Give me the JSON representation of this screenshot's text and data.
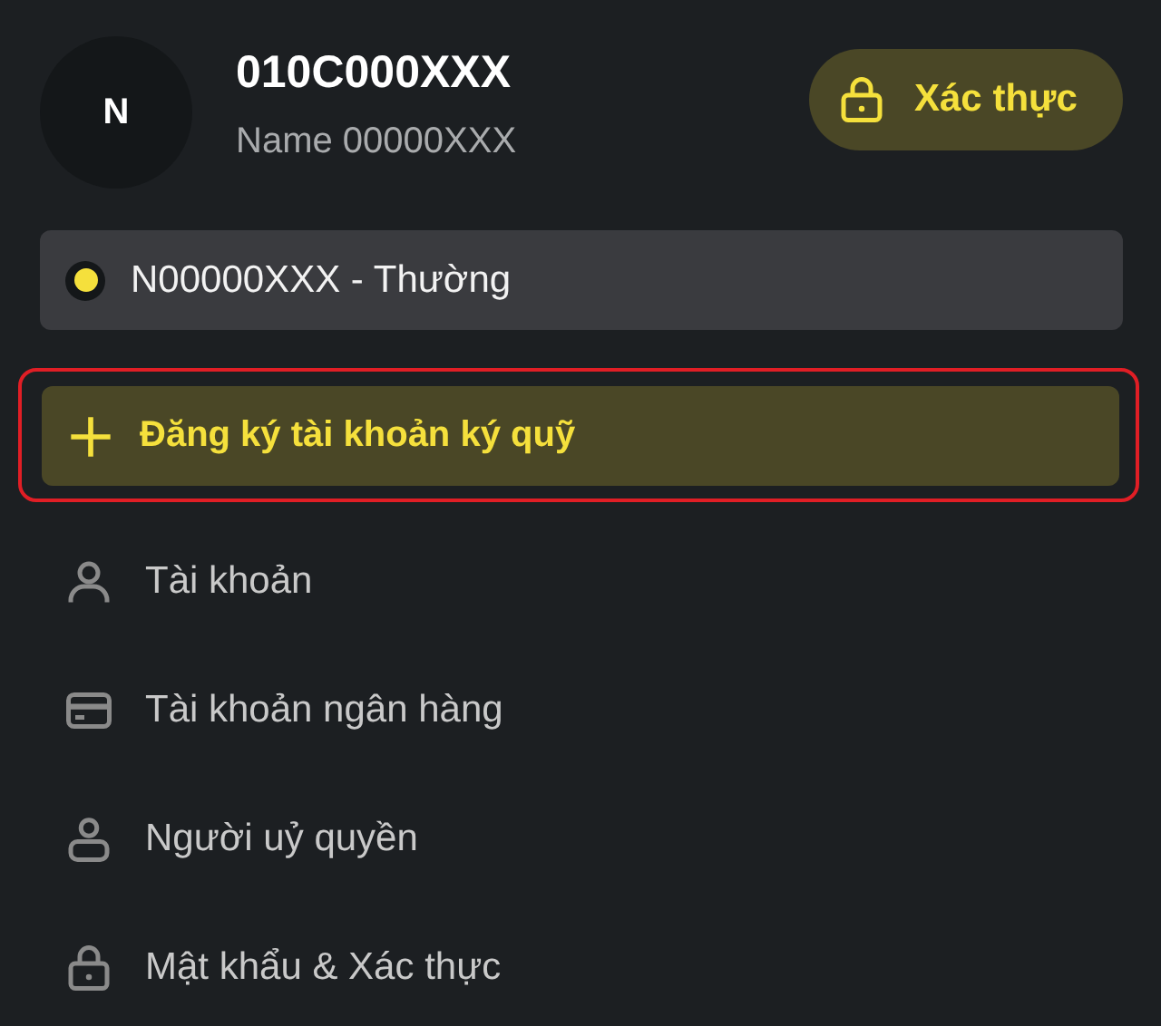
{
  "profile": {
    "avatar_initial": "N",
    "account_id": "010C000XXX",
    "name": "Name 00000XXX"
  },
  "verify_button": {
    "label": "Xác thực"
  },
  "sub_account": {
    "label": "N00000XXX - Thường",
    "color": "#f5e03c"
  },
  "register_button": {
    "label": "Đăng ký tài khoản ký quỹ",
    "highlighted": true
  },
  "menu": [
    {
      "kind": "account",
      "label": "Tài khoản"
    },
    {
      "kind": "bank",
      "label": "Tài khoản ngân hàng"
    },
    {
      "kind": "delegate",
      "label": "Người uỷ quyền"
    },
    {
      "kind": "password",
      "label": "Mật khẩu & Xác thực"
    }
  ]
}
